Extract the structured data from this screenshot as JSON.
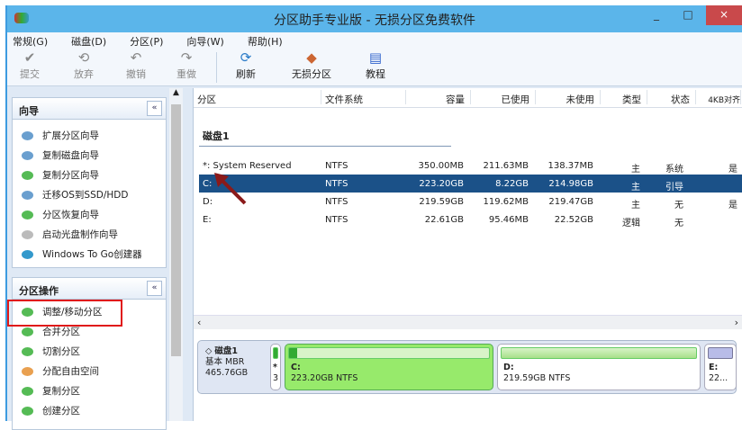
{
  "window": {
    "title": "分区助手专业版 - 无损分区免费软件",
    "minimize": "_",
    "maximize": "□",
    "close": "×"
  },
  "menu": [
    "常规(G)",
    "磁盘(D)",
    "分区(P)",
    "向导(W)",
    "帮助(H)"
  ],
  "toolbar": {
    "commit": "提交",
    "discard": "放弃",
    "undo": "撤销",
    "redo": "重做",
    "refresh": "刷新",
    "lossless": "无损分区",
    "tutorial": "教程"
  },
  "wizard": {
    "title": "向导",
    "collapse": "«",
    "items": [
      "扩展分区向导",
      "复制磁盘向导",
      "复制分区向导",
      "迁移OS到SSD/HDD",
      "分区恢复向导",
      "启动光盘制作向导",
      "Windows To Go创建器"
    ]
  },
  "ops": {
    "title": "分区操作",
    "collapse": "«",
    "items": [
      "调整/移动分区",
      "合并分区",
      "切割分区",
      "分配自由空间",
      "复制分区",
      "创建分区"
    ]
  },
  "table": {
    "headers": [
      "分区",
      "文件系统",
      "容量",
      "已使用",
      "未使用",
      "类型",
      "状态",
      "4KB对齐"
    ],
    "disk": "磁盘1",
    "rows": [
      [
        "*: System Reserved",
        "NTFS",
        "350.00MB",
        "211.63MB",
        "138.37MB",
        "主",
        "系统",
        "是"
      ],
      [
        "C:",
        "NTFS",
        "223.20GB",
        "8.22GB",
        "214.98GB",
        "主",
        "引导",
        ""
      ],
      [
        "D:",
        "NTFS",
        "219.59GB",
        "119.62MB",
        "219.47GB",
        "主",
        "无",
        "是"
      ],
      [
        "E:",
        "NTFS",
        "22.61GB",
        "95.46MB",
        "22.52GB",
        "逻辑",
        "无",
        ""
      ]
    ]
  },
  "diskmap": {
    "name": "磁盘1",
    "type": "基本 MBR",
    "size": "465.76GB",
    "sys_l1": "*",
    "sys_l2": "3",
    "c_l1": "C:",
    "c_l2": "223.20GB NTFS",
    "d_l1": "D:",
    "d_l2": "219.59GB NTFS",
    "e_l1": "E:",
    "e_l2": "22..."
  },
  "colors": {
    "selected": "#1b5188",
    "titlebar": "#5bb5ea",
    "highlight": "#e01818"
  }
}
